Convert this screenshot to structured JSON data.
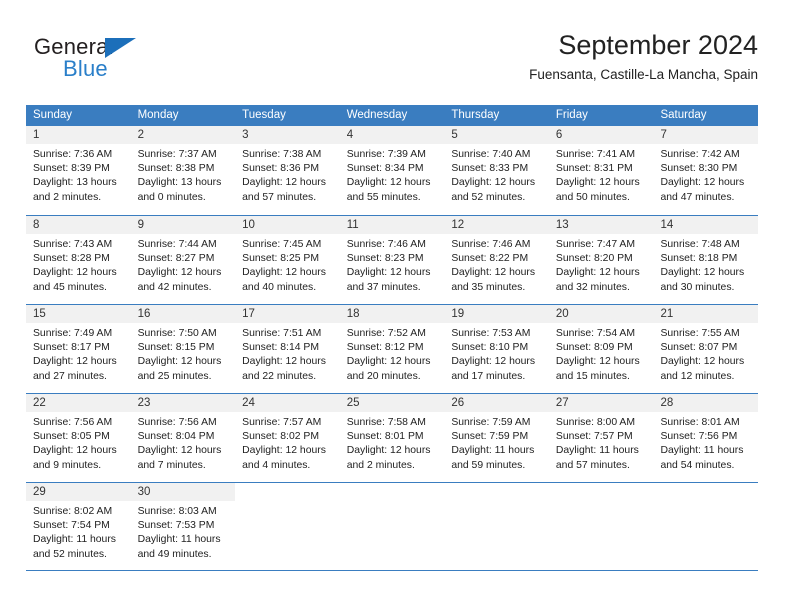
{
  "brand": {
    "name_top": "General",
    "name_bottom": "Blue",
    "triangle_icon": "triangle-icon",
    "accent_color": "#2a7fc9"
  },
  "header": {
    "title": "September 2024",
    "subtitle": "Fuensanta, Castille-La Mancha, Spain"
  },
  "colors": {
    "header_blue": "#3a7dc0",
    "daynum_band": "#f1f1f1",
    "text": "#222222"
  },
  "weekdays": [
    "Sunday",
    "Monday",
    "Tuesday",
    "Wednesday",
    "Thursday",
    "Friday",
    "Saturday"
  ],
  "weeks": [
    [
      {
        "day": "1",
        "sunrise": "Sunrise: 7:36 AM",
        "sunset": "Sunset: 8:39 PM",
        "daylight_1": "Daylight: 13 hours",
        "daylight_2": "and 2 minutes."
      },
      {
        "day": "2",
        "sunrise": "Sunrise: 7:37 AM",
        "sunset": "Sunset: 8:38 PM",
        "daylight_1": "Daylight: 13 hours",
        "daylight_2": "and 0 minutes."
      },
      {
        "day": "3",
        "sunrise": "Sunrise: 7:38 AM",
        "sunset": "Sunset: 8:36 PM",
        "daylight_1": "Daylight: 12 hours",
        "daylight_2": "and 57 minutes."
      },
      {
        "day": "4",
        "sunrise": "Sunrise: 7:39 AM",
        "sunset": "Sunset: 8:34 PM",
        "daylight_1": "Daylight: 12 hours",
        "daylight_2": "and 55 minutes."
      },
      {
        "day": "5",
        "sunrise": "Sunrise: 7:40 AM",
        "sunset": "Sunset: 8:33 PM",
        "daylight_1": "Daylight: 12 hours",
        "daylight_2": "and 52 minutes."
      },
      {
        "day": "6",
        "sunrise": "Sunrise: 7:41 AM",
        "sunset": "Sunset: 8:31 PM",
        "daylight_1": "Daylight: 12 hours",
        "daylight_2": "and 50 minutes."
      },
      {
        "day": "7",
        "sunrise": "Sunrise: 7:42 AM",
        "sunset": "Sunset: 8:30 PM",
        "daylight_1": "Daylight: 12 hours",
        "daylight_2": "and 47 minutes."
      }
    ],
    [
      {
        "day": "8",
        "sunrise": "Sunrise: 7:43 AM",
        "sunset": "Sunset: 8:28 PM",
        "daylight_1": "Daylight: 12 hours",
        "daylight_2": "and 45 minutes."
      },
      {
        "day": "9",
        "sunrise": "Sunrise: 7:44 AM",
        "sunset": "Sunset: 8:27 PM",
        "daylight_1": "Daylight: 12 hours",
        "daylight_2": "and 42 minutes."
      },
      {
        "day": "10",
        "sunrise": "Sunrise: 7:45 AM",
        "sunset": "Sunset: 8:25 PM",
        "daylight_1": "Daylight: 12 hours",
        "daylight_2": "and 40 minutes."
      },
      {
        "day": "11",
        "sunrise": "Sunrise: 7:46 AM",
        "sunset": "Sunset: 8:23 PM",
        "daylight_1": "Daylight: 12 hours",
        "daylight_2": "and 37 minutes."
      },
      {
        "day": "12",
        "sunrise": "Sunrise: 7:46 AM",
        "sunset": "Sunset: 8:22 PM",
        "daylight_1": "Daylight: 12 hours",
        "daylight_2": "and 35 minutes."
      },
      {
        "day": "13",
        "sunrise": "Sunrise: 7:47 AM",
        "sunset": "Sunset: 8:20 PM",
        "daylight_1": "Daylight: 12 hours",
        "daylight_2": "and 32 minutes."
      },
      {
        "day": "14",
        "sunrise": "Sunrise: 7:48 AM",
        "sunset": "Sunset: 8:18 PM",
        "daylight_1": "Daylight: 12 hours",
        "daylight_2": "and 30 minutes."
      }
    ],
    [
      {
        "day": "15",
        "sunrise": "Sunrise: 7:49 AM",
        "sunset": "Sunset: 8:17 PM",
        "daylight_1": "Daylight: 12 hours",
        "daylight_2": "and 27 minutes."
      },
      {
        "day": "16",
        "sunrise": "Sunrise: 7:50 AM",
        "sunset": "Sunset: 8:15 PM",
        "daylight_1": "Daylight: 12 hours",
        "daylight_2": "and 25 minutes."
      },
      {
        "day": "17",
        "sunrise": "Sunrise: 7:51 AM",
        "sunset": "Sunset: 8:14 PM",
        "daylight_1": "Daylight: 12 hours",
        "daylight_2": "and 22 minutes."
      },
      {
        "day": "18",
        "sunrise": "Sunrise: 7:52 AM",
        "sunset": "Sunset: 8:12 PM",
        "daylight_1": "Daylight: 12 hours",
        "daylight_2": "and 20 minutes."
      },
      {
        "day": "19",
        "sunrise": "Sunrise: 7:53 AM",
        "sunset": "Sunset: 8:10 PM",
        "daylight_1": "Daylight: 12 hours",
        "daylight_2": "and 17 minutes."
      },
      {
        "day": "20",
        "sunrise": "Sunrise: 7:54 AM",
        "sunset": "Sunset: 8:09 PM",
        "daylight_1": "Daylight: 12 hours",
        "daylight_2": "and 15 minutes."
      },
      {
        "day": "21",
        "sunrise": "Sunrise: 7:55 AM",
        "sunset": "Sunset: 8:07 PM",
        "daylight_1": "Daylight: 12 hours",
        "daylight_2": "and 12 minutes."
      }
    ],
    [
      {
        "day": "22",
        "sunrise": "Sunrise: 7:56 AM",
        "sunset": "Sunset: 8:05 PM",
        "daylight_1": "Daylight: 12 hours",
        "daylight_2": "and 9 minutes."
      },
      {
        "day": "23",
        "sunrise": "Sunrise: 7:56 AM",
        "sunset": "Sunset: 8:04 PM",
        "daylight_1": "Daylight: 12 hours",
        "daylight_2": "and 7 minutes."
      },
      {
        "day": "24",
        "sunrise": "Sunrise: 7:57 AM",
        "sunset": "Sunset: 8:02 PM",
        "daylight_1": "Daylight: 12 hours",
        "daylight_2": "and 4 minutes."
      },
      {
        "day": "25",
        "sunrise": "Sunrise: 7:58 AM",
        "sunset": "Sunset: 8:01 PM",
        "daylight_1": "Daylight: 12 hours",
        "daylight_2": "and 2 minutes."
      },
      {
        "day": "26",
        "sunrise": "Sunrise: 7:59 AM",
        "sunset": "Sunset: 7:59 PM",
        "daylight_1": "Daylight: 11 hours",
        "daylight_2": "and 59 minutes."
      },
      {
        "day": "27",
        "sunrise": "Sunrise: 8:00 AM",
        "sunset": "Sunset: 7:57 PM",
        "daylight_1": "Daylight: 11 hours",
        "daylight_2": "and 57 minutes."
      },
      {
        "day": "28",
        "sunrise": "Sunrise: 8:01 AM",
        "sunset": "Sunset: 7:56 PM",
        "daylight_1": "Daylight: 11 hours",
        "daylight_2": "and 54 minutes."
      }
    ],
    [
      {
        "day": "29",
        "sunrise": "Sunrise: 8:02 AM",
        "sunset": "Sunset: 7:54 PM",
        "daylight_1": "Daylight: 11 hours",
        "daylight_2": "and 52 minutes."
      },
      {
        "day": "30",
        "sunrise": "Sunrise: 8:03 AM",
        "sunset": "Sunset: 7:53 PM",
        "daylight_1": "Daylight: 11 hours",
        "daylight_2": "and 49 minutes."
      },
      {
        "day": "",
        "sunrise": "",
        "sunset": "",
        "daylight_1": "",
        "daylight_2": ""
      },
      {
        "day": "",
        "sunrise": "",
        "sunset": "",
        "daylight_1": "",
        "daylight_2": ""
      },
      {
        "day": "",
        "sunrise": "",
        "sunset": "",
        "daylight_1": "",
        "daylight_2": ""
      },
      {
        "day": "",
        "sunrise": "",
        "sunset": "",
        "daylight_1": "",
        "daylight_2": ""
      },
      {
        "day": "",
        "sunrise": "",
        "sunset": "",
        "daylight_1": "",
        "daylight_2": ""
      }
    ]
  ]
}
